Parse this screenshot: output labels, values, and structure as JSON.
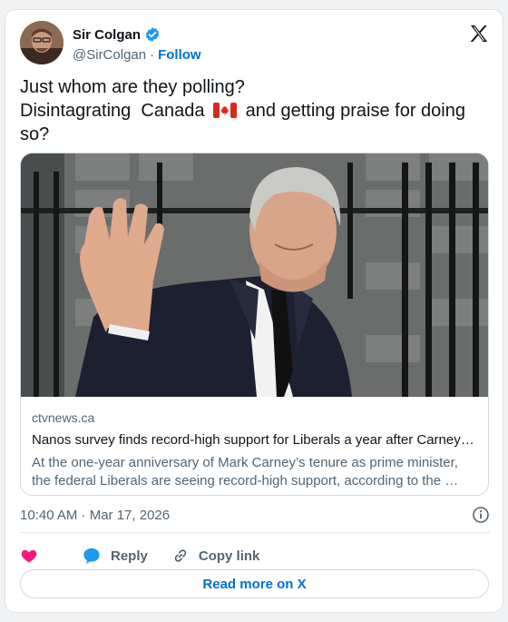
{
  "author": {
    "display_name": "Sir Colgan",
    "handle": "@SirColgan",
    "separator": "·",
    "follow_label": "Follow"
  },
  "tweet": {
    "line1": "Just whom are they polling?",
    "line2_before_flag": "Disintagrating  Canada ",
    "line2_after_flag": " and getting praise for doing",
    "line3": "so?"
  },
  "link_card": {
    "domain": "ctvnews.ca",
    "title": "Nanos survey finds record-high support for Liberals a year after Carney…",
    "description": "At the one-year anniversary of Mark Carney’s tenure as prime minister, the federal Liberals are seeing record-high support, according to the …"
  },
  "timestamp": "10:40 AM · Mar 17, 2026",
  "actions": {
    "reply_label": "Reply",
    "copy_link_label": "Copy link"
  },
  "read_more_label": "Read more on X",
  "colors": {
    "accent_blue": "#006fd6",
    "verified_blue": "#1d9bf0",
    "heart_pink": "#f91880",
    "reply_blue": "#1d9bf0"
  }
}
